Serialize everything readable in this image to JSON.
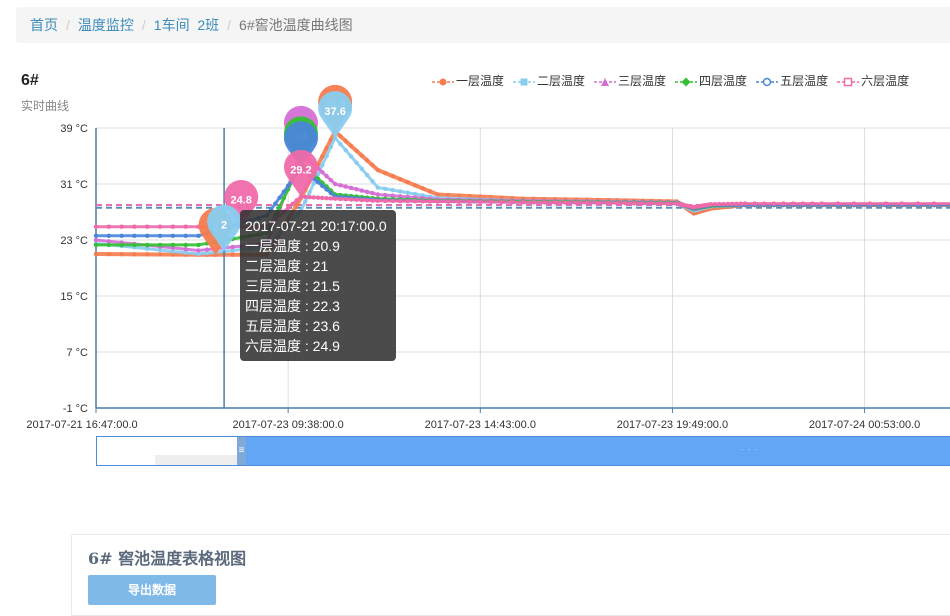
{
  "breadcrumb": {
    "items": [
      "首页",
      "温度监控",
      "1车间",
      "2班"
    ],
    "current": "6#窖池温度曲线图"
  },
  "chart_header": {
    "title": "6#",
    "subtitle": "实时曲线"
  },
  "legend": [
    {
      "name": "一层温度",
      "color": "#f57c4f",
      "marker": "circle"
    },
    {
      "name": "二层温度",
      "color": "#88ccf0",
      "marker": "square"
    },
    {
      "name": "三层温度",
      "color": "#d46fd6",
      "marker": "triangle"
    },
    {
      "name": "四层温度",
      "color": "#33c033",
      "marker": "diamond"
    },
    {
      "name": "五层温度",
      "color": "#4a86d8",
      "marker": "empty-circle"
    },
    {
      "name": "六层温度",
      "color": "#f06aaa",
      "marker": "empty-square"
    }
  ],
  "tooltip": {
    "time": "2017-07-21 20:17:00.0",
    "rows": [
      "一层温度 : 20.9",
      "二层温度 : 21",
      "三层温度 : 21.5",
      "四层温度 : 22.3",
      "五层温度 : 23.6",
      "六层温度 : 24.9"
    ]
  },
  "slider": {
    "range_start": 0.16,
    "range_end": 1.0
  },
  "table_panel": {
    "title": "6# 窖池温度表格视图",
    "export_label": "导出数据"
  },
  "chart_data": {
    "type": "line",
    "y_ticks": [
      "39 °C",
      "31 °C",
      "23 °C",
      "15 °C",
      "7 °C",
      "-1 °C"
    ],
    "ylim": [
      -1,
      39
    ],
    "x_ticks": [
      "2017-07-21 16:47:00.0",
      "2017-07-23 09:38:00.0",
      "2017-07-23 14:43:00.0",
      "2017-07-23 19:49:00.0",
      "2017-07-24 00:53:00.0"
    ],
    "x": [
      0,
      0.12,
      0.2,
      0.24,
      0.28,
      0.33,
      0.4,
      0.5,
      0.6,
      0.68,
      0.7,
      0.72,
      0.76,
      0.85,
      1.0
    ],
    "series": [
      {
        "name": "一层温度",
        "values": [
          21.0,
          20.9,
          20.9,
          29.0,
          38.5,
          33.0,
          29.5,
          28.9,
          28.7,
          28.5,
          26.8,
          27.5,
          28.0,
          28.0,
          28.0
        ]
      },
      {
        "name": "二层温度",
        "values": [
          22.5,
          21.0,
          22.0,
          27.2,
          37.6,
          30.5,
          29.0,
          28.6,
          28.5,
          28.4,
          27.2,
          27.8,
          28.0,
          28.0,
          28.0
        ]
      },
      {
        "name": "三层温度",
        "values": [
          23.0,
          21.5,
          22.5,
          35.5,
          31.0,
          29.5,
          28.8,
          28.6,
          28.5,
          28.4,
          27.4,
          27.9,
          28.0,
          28.0,
          28.0
        ]
      },
      {
        "name": "四层温度",
        "values": [
          22.3,
          22.3,
          24.0,
          34.0,
          29.5,
          28.9,
          28.6,
          28.5,
          28.4,
          28.3,
          27.5,
          27.9,
          28.0,
          28.0,
          28.0
        ]
      },
      {
        "name": "五层温度",
        "values": [
          23.6,
          23.6,
          26.5,
          33.3,
          29.2,
          28.7,
          28.5,
          28.4,
          28.3,
          28.2,
          27.6,
          28.0,
          28.0,
          28.0,
          28.0
        ]
      },
      {
        "name": "六层温度",
        "values": [
          24.9,
          24.9,
          24.9,
          29.2,
          28.9,
          28.6,
          28.5,
          28.4,
          28.3,
          28.2,
          27.7,
          28.1,
          28.2,
          28.2,
          28.2
        ]
      }
    ],
    "markers": [
      {
        "series": "一层温度",
        "x": 0.28,
        "label": "38.5"
      },
      {
        "series": "二层温度",
        "x": 0.28,
        "label": "37.6"
      },
      {
        "series": "三层温度",
        "x": 0.24,
        "label": "35.5"
      },
      {
        "series": "四层温度",
        "x": 0.24,
        "label": "34"
      },
      {
        "series": "五层温度",
        "x": 0.24,
        "label": ""
      },
      {
        "series": "六层温度",
        "x": 0.24,
        "label": "29.2"
      },
      {
        "series": "六层温度",
        "x": 0.17,
        "label": "24.8"
      },
      {
        "series": "一层温度",
        "x": 0.14,
        "label": "2"
      },
      {
        "series": "二层温度",
        "x": 0.15,
        "label": "2"
      }
    ],
    "avg_lines": [
      27.6,
      28.0
    ],
    "crosshair_x": 0.15,
    "grid": true
  }
}
